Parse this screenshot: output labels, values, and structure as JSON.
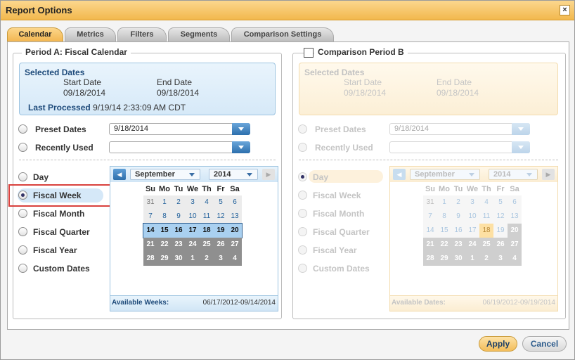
{
  "title": "Report Options",
  "close_glyph": "×",
  "tabs": [
    "Calendar",
    "Metrics",
    "Filters",
    "Segments",
    "Comparison Settings"
  ],
  "active_tab": "Calendar",
  "period_a": {
    "legend": "Period A: Fiscal Calendar",
    "selected_dates_label": "Selected Dates",
    "start_label": "Start Date",
    "start_value": "09/18/2014",
    "end_label": "End Date",
    "end_value": "09/18/2014",
    "last_processed_label": "Last Processed",
    "last_processed_value": "9/19/14 2:33:09 AM CDT",
    "preset_label": "Preset Dates",
    "preset_value": "9/18/2014",
    "recent_label": "Recently Used",
    "recent_value": "",
    "ranges": [
      "Day",
      "Fiscal Week",
      "Fiscal Month",
      "Fiscal Quarter",
      "Fiscal Year",
      "Custom Dates"
    ],
    "selected_range": "Fiscal Week",
    "calendar": {
      "month": "September",
      "year": "2014",
      "dow": [
        "Su",
        "Mo",
        "Tu",
        "We",
        "Th",
        "Fr",
        "Sa"
      ],
      "weeks": [
        [
          "31",
          "1",
          "2",
          "3",
          "4",
          "5",
          "6"
        ],
        [
          "7",
          "8",
          "9",
          "10",
          "11",
          "12",
          "13"
        ],
        [
          "14",
          "15",
          "16",
          "17",
          "18",
          "19",
          "20"
        ],
        [
          "21",
          "22",
          "23",
          "24",
          "25",
          "26",
          "27"
        ],
        [
          "28",
          "29",
          "30",
          "1",
          "2",
          "3",
          "4"
        ]
      ],
      "available_label": "Available Weeks:",
      "available_value": "06/17/2012-09/14/2014"
    }
  },
  "period_b": {
    "legend": "Comparison Period B",
    "checked": false,
    "selected_dates_label": "Selected Dates",
    "start_label": "Start Date",
    "start_value": "09/18/2014",
    "end_label": "End Date",
    "end_value": "09/18/2014",
    "preset_label": "Preset Dates",
    "preset_value": "9/18/2014",
    "recent_label": "Recently Used",
    "recent_value": "",
    "ranges": [
      "Day",
      "Fiscal Week",
      "Fiscal Month",
      "Fiscal Quarter",
      "Fiscal Year",
      "Custom Dates"
    ],
    "selected_range": "Day",
    "calendar": {
      "month": "September",
      "year": "2014",
      "dow": [
        "Su",
        "Mo",
        "Tu",
        "We",
        "Th",
        "Fr",
        "Sa"
      ],
      "weeks": [
        [
          "31",
          "1",
          "2",
          "3",
          "4",
          "5",
          "6"
        ],
        [
          "7",
          "8",
          "9",
          "10",
          "11",
          "12",
          "13"
        ],
        [
          "14",
          "15",
          "16",
          "17",
          "18",
          "19",
          "20"
        ],
        [
          "21",
          "22",
          "23",
          "24",
          "25",
          "26",
          "27"
        ],
        [
          "28",
          "29",
          "30",
          "1",
          "2",
          "3",
          "4"
        ]
      ],
      "today": "18",
      "available_label": "Available Dates:",
      "available_value": "06/19/2012-09/19/2014"
    }
  },
  "buttons": {
    "apply": "Apply",
    "cancel": "Cancel"
  },
  "colors": {
    "accent": "#f3bd5a",
    "primary_blue": "#2c6fad",
    "highlight_red": "#d9413d"
  }
}
